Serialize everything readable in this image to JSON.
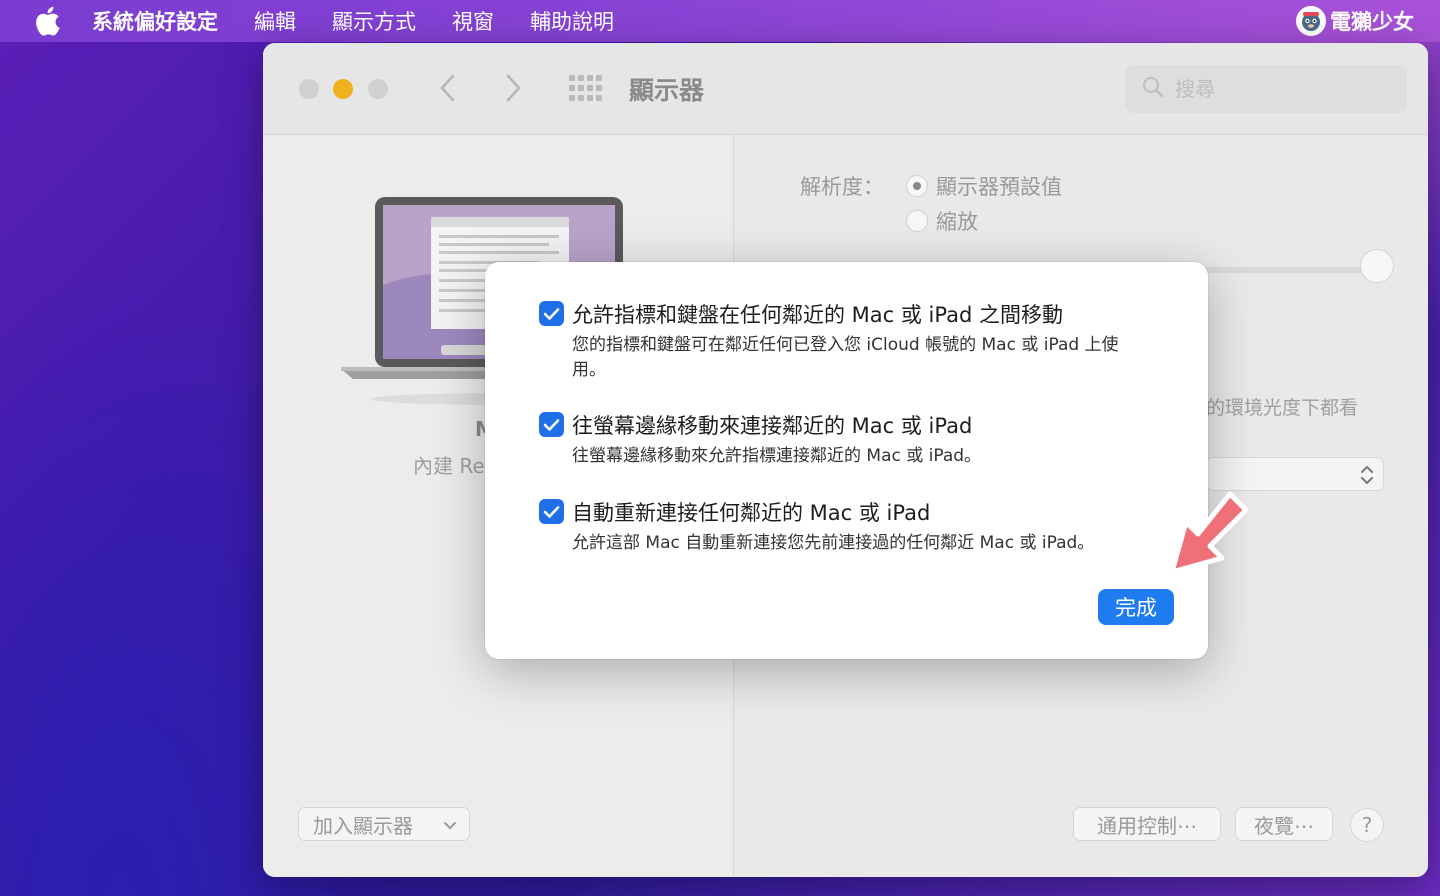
{
  "menubar": {
    "app_name": "系統偏好設定",
    "items": [
      "編輯",
      "顯示方式",
      "視窗",
      "輔助說明"
    ],
    "brand": "電獺少女"
  },
  "window": {
    "title": "顯示器",
    "search_placeholder": "搜尋"
  },
  "left": {
    "display_name": "M",
    "display_sub": "內建 Re",
    "add_display_label": "加入顯示器"
  },
  "right": {
    "resolution_label": "解析度：",
    "radio_default": "顯示器預設值",
    "radio_scaled": "縮放",
    "ambient_text": "的環境光度下都看",
    "universal_control_label": "通用控制⋯",
    "night_shift_label": "夜覽⋯",
    "help_label": "?"
  },
  "dialog": {
    "options": [
      {
        "title": "允許指標和鍵盤在任何鄰近的 Mac 或 iPad 之間移動",
        "desc": "您的指標和鍵盤可在鄰近任何已登入您 iCloud 帳號的 Mac 或 iPad 上使用。",
        "checked": true
      },
      {
        "title": "往螢幕邊緣移動來連接鄰近的 Mac 或 iPad",
        "desc": "往螢幕邊緣移動來允許指標連接鄰近的 Mac 或 iPad。",
        "checked": true
      },
      {
        "title": "自動重新連接任何鄰近的 Mac 或 iPad",
        "desc": "允許這部 Mac 自動重新連接您先前連接過的任何鄰近 Mac 或 iPad。",
        "checked": true
      }
    ],
    "done_label": "完成"
  },
  "colors": {
    "accent": "#1f7bf0",
    "annotation_arrow": "#f0707a",
    "minimize": "#f0b120"
  }
}
